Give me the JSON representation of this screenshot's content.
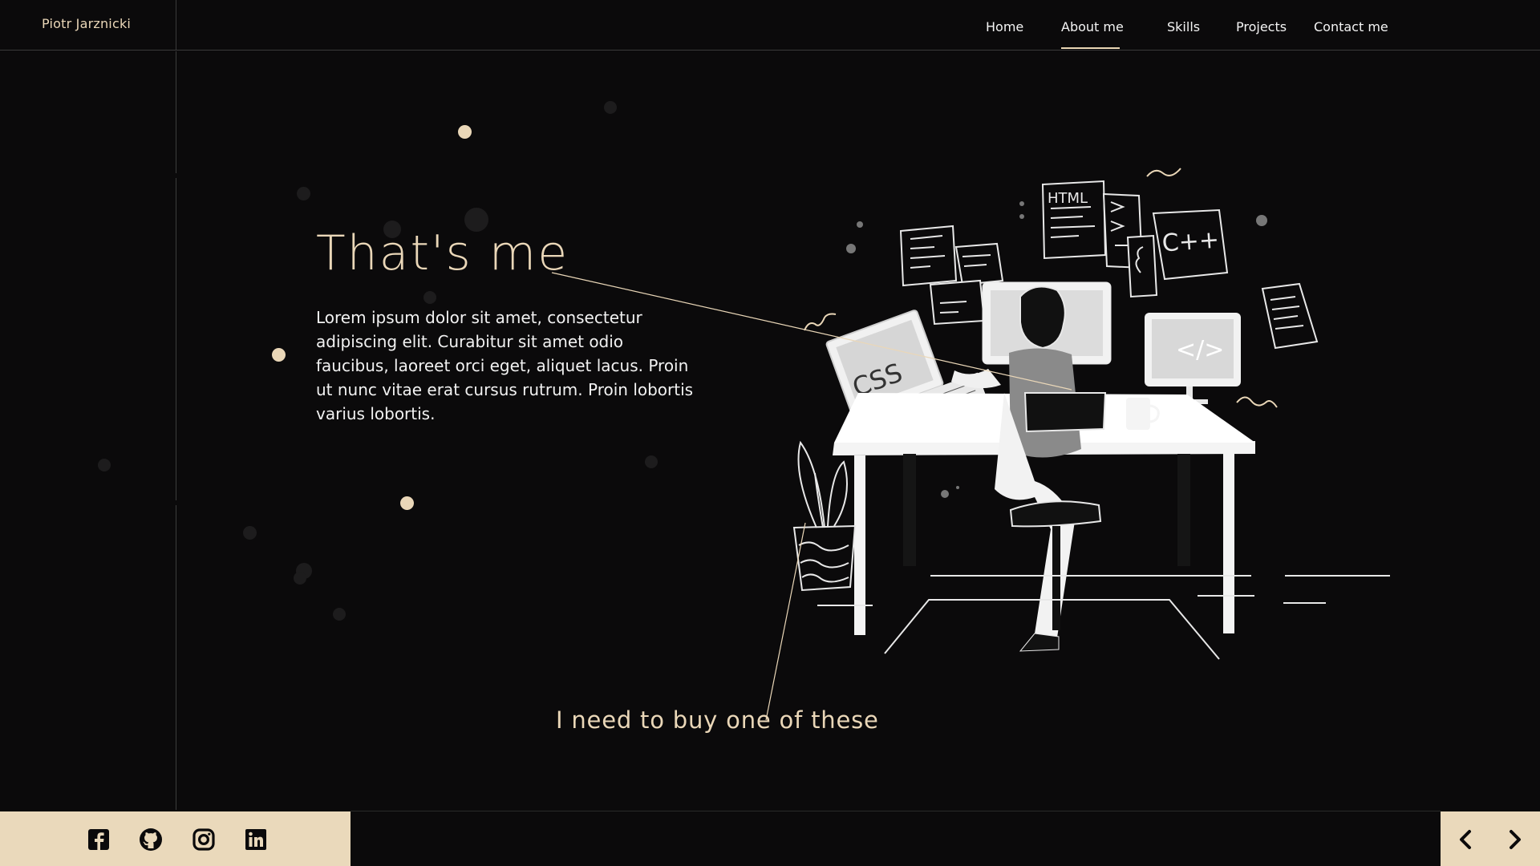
{
  "header": {
    "brand": "Piotr Jarznicki",
    "nav": [
      {
        "label": "Home"
      },
      {
        "label": "About me",
        "active": true
      },
      {
        "label": "Skills"
      },
      {
        "label": "Projects"
      },
      {
        "label": "Contact me"
      }
    ]
  },
  "hero": {
    "title": "That's me",
    "text": "Lorem ipsum dolor sit amet, consectetur adipiscing elit. Curabitur sit amet odio faucibus, laoreet orci eget, aliquet lacus. Proin ut nunc vitae erat cursus rutrum. Proin lobortis varius lobortis.",
    "caption": "I need to buy one of these"
  },
  "illustration": {
    "labels": {
      "html": "HTML",
      "css": "CSS",
      "cpp": "C++",
      "code": "</>"
    }
  },
  "footer": {
    "socials": [
      "facebook-icon",
      "github-icon",
      "instagram-icon",
      "linkedin-icon"
    ],
    "arrows": [
      "chevron-left-icon",
      "chevron-right-icon"
    ]
  },
  "colors": {
    "background": "#0b0a0b",
    "accent": "#ead7b8",
    "text": "#f2f2f2",
    "footer": "#ead9bb"
  }
}
